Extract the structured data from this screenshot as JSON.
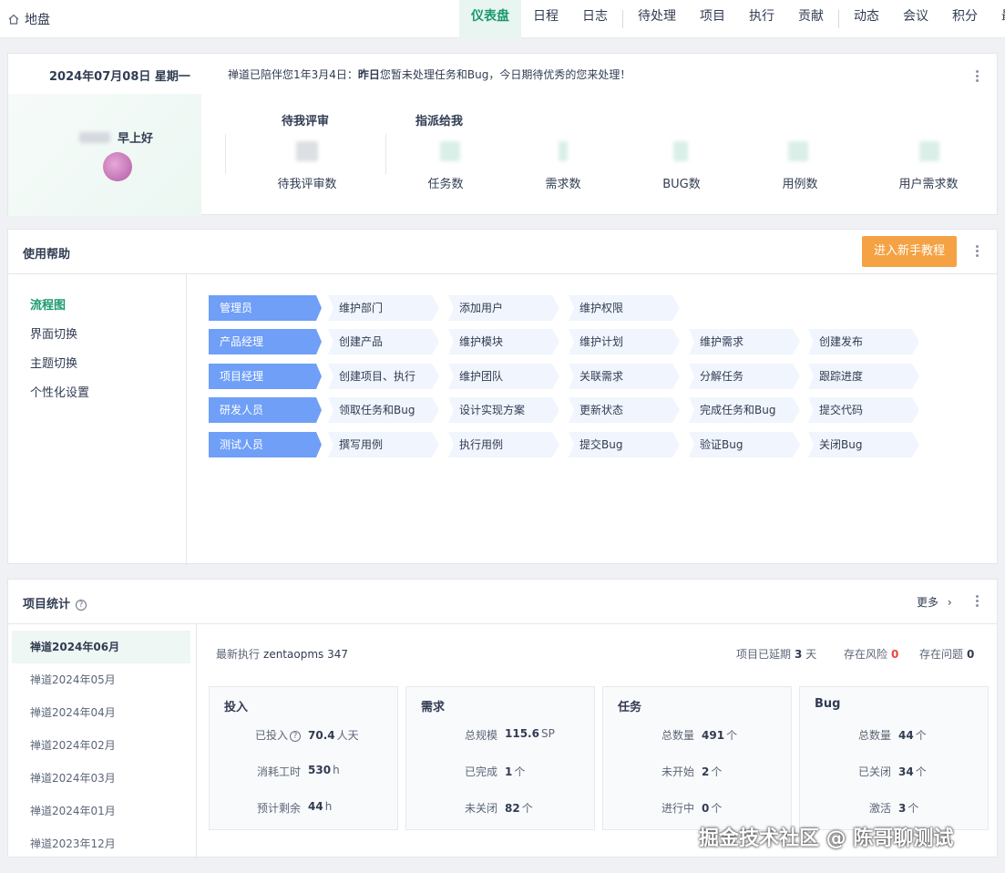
{
  "topbar": {
    "home_label": "地盘",
    "nav": [
      "仪表盘",
      "日程",
      "日志",
      "待处理",
      "项目",
      "执行",
      "贡献",
      "动态",
      "会议",
      "积分",
      "最"
    ]
  },
  "welcome": {
    "date": "2024年07月08日 星期一",
    "notice_prefix": "禅道已陪伴您1年3月4日：",
    "notice_bold": "昨日",
    "notice_suffix": "您暂未处理任务和Bug，今日期待优秀的您来处理！",
    "greeting": "早上好",
    "review_title": "待我评审",
    "assign_title": "指派给我",
    "stats": [
      "待我评审数",
      "任务数",
      "需求数",
      "BUG数",
      "用例数",
      "用户需求数"
    ]
  },
  "help": {
    "title": "使用帮助",
    "tutorial_button": "进入新手教程",
    "menu": [
      "流程图",
      "界面切换",
      "主题切换",
      "个性化设置"
    ],
    "flows": [
      {
        "role": "管理员",
        "steps": [
          "维护部门",
          "添加用户",
          "维护权限"
        ]
      },
      {
        "role": "产品经理",
        "steps": [
          "创建产品",
          "维护模块",
          "维护计划",
          "维护需求",
          "创建发布"
        ]
      },
      {
        "role": "项目经理",
        "steps": [
          "创建项目、执行",
          "维护团队",
          "关联需求",
          "分解任务",
          "跟踪进度"
        ]
      },
      {
        "role": "研发人员",
        "steps": [
          "领取任务和Bug",
          "设计实现方案",
          "更新状态",
          "完成任务和Bug",
          "提交代码"
        ]
      },
      {
        "role": "测试人员",
        "steps": [
          "撰写用例",
          "执行用例",
          "提交Bug",
          "验证Bug",
          "关闭Bug"
        ]
      }
    ]
  },
  "project": {
    "title": "项目统计",
    "more": "更多",
    "projects": [
      "禅道2024年06月",
      "禅道2024年05月",
      "禅道2024年04月",
      "禅道2024年02月",
      "禅道2024年03月",
      "禅道2024年01月",
      "禅道2023年12月"
    ],
    "latest_label": "最新执行",
    "latest_value": "zentaopms 347",
    "delay_label": "项目已延期",
    "delay_value": "3",
    "delay_unit": "天",
    "risk_label": "存在风险",
    "risk_value": "0",
    "issue_label": "存在问题",
    "issue_value": "0",
    "cards": [
      {
        "title": "投入",
        "rows": [
          {
            "k": "已投入",
            "v": "70.4",
            "u": "人天"
          },
          {
            "k": "消耗工时",
            "v": "530",
            "u": "h"
          },
          {
            "k": "预计剩余",
            "v": "44",
            "u": "h"
          }
        ]
      },
      {
        "title": "需求",
        "rows": [
          {
            "k": "总规模",
            "v": "115.6",
            "u": "SP"
          },
          {
            "k": "已完成",
            "v": "1",
            "u": "个"
          },
          {
            "k": "未关闭",
            "v": "82",
            "u": "个"
          }
        ]
      },
      {
        "title": "任务",
        "rows": [
          {
            "k": "总数量",
            "v": "491",
            "u": "个"
          },
          {
            "k": "未开始",
            "v": "2",
            "u": "个"
          },
          {
            "k": "进行中",
            "v": "0",
            "u": "个"
          }
        ]
      },
      {
        "title": "Bug",
        "rows": [
          {
            "k": "总数量",
            "v": "44",
            "u": "个"
          },
          {
            "k": "已关闭",
            "v": "34",
            "u": "个"
          },
          {
            "k": "激活",
            "v": "3",
            "u": "个"
          }
        ]
      }
    ]
  },
  "watermark": "掘金技术社区 @ 陈哥聊测试"
}
